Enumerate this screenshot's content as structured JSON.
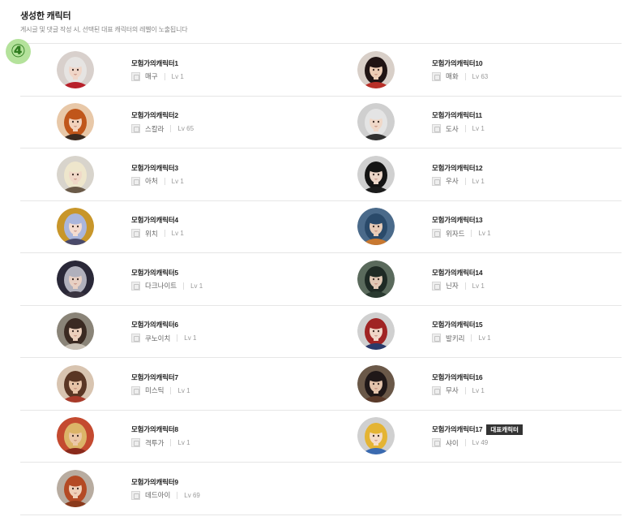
{
  "section": {
    "title": "생성한 캐릭터",
    "subtitle": "게시글 및 댓글 작성 시, 선택된 대표 캐릭터의 레벨이 노출됩니다",
    "annotation_marker": "④"
  },
  "representative_badge_label": "대표캐릭터",
  "colors": {
    "title": "#222222",
    "subtitle": "#888888",
    "divider": "#e6e6e6",
    "badge_bg": "#333333",
    "marker_bg": "#b4e29b",
    "marker_fg": "#2f7d1f"
  },
  "columns": [
    {
      "characters": [
        {
          "name": "모험가의캐릭터1",
          "class": "매구",
          "level": "Lv 1",
          "is_representative": false,
          "class_icon": "class-maegu-icon",
          "avatar": {
            "bg": "#d8d0cc",
            "hair": "#e6e4e2",
            "skin": "#f0d6c8",
            "outfit": "#b8202a"
          }
        },
        {
          "name": "모험가의캐릭터2",
          "class": "스칼라",
          "level": "Lv 65",
          "is_representative": false,
          "class_icon": "class-scholar-icon",
          "avatar": {
            "bg": "#e8c8a8",
            "hair": "#c0561a",
            "skin": "#f2d2bc",
            "outfit": "#3a2a20"
          }
        },
        {
          "name": "모험가의캐릭터3",
          "class": "아처",
          "level": "Lv 1",
          "is_representative": false,
          "class_icon": "class-archer-icon",
          "avatar": {
            "bg": "#d8d4cc",
            "hair": "#eee6cc",
            "skin": "#f0d8c8",
            "outfit": "#6a5a48"
          }
        },
        {
          "name": "모험가의캐릭터4",
          "class": "위치",
          "level": "Lv 1",
          "is_representative": false,
          "class_icon": "class-witch-icon",
          "avatar": {
            "bg": "#c8962a",
            "hair": "#aab6dc",
            "skin": "#f4dcd0",
            "outfit": "#4a4a6a"
          }
        },
        {
          "name": "모험가의캐릭터5",
          "class": "다크나이트",
          "level": "Lv 1",
          "is_representative": false,
          "class_icon": "class-darkknight-icon",
          "avatar": {
            "bg": "#2a2838",
            "hair": "#b0b0bc",
            "skin": "#e8d0c4",
            "outfit": "#3a3440"
          }
        },
        {
          "name": "모험가의캐릭터6",
          "class": "쿠노이치",
          "level": "Lv 1",
          "is_representative": false,
          "class_icon": "class-kunoichi-icon",
          "avatar": {
            "bg": "#8a8478",
            "hair": "#3a2a22",
            "skin": "#ecd0bc",
            "outfit": "#c8c0b4"
          }
        },
        {
          "name": "모험가의캐릭터7",
          "class": "미스틱",
          "level": "Lv 1",
          "is_representative": false,
          "class_icon": "class-mystic-icon",
          "avatar": {
            "bg": "#d8c4b0",
            "hair": "#5a3624",
            "skin": "#e8c4a8",
            "outfit": "#a83a2a"
          }
        },
        {
          "name": "모험가의캐릭터8",
          "class": "격투가",
          "level": "Lv 1",
          "is_representative": false,
          "class_icon": "class-striker-icon",
          "avatar": {
            "bg": "#c44a30",
            "hair": "#dcb468",
            "skin": "#ecc8a8",
            "outfit": "#8a2a1c"
          }
        },
        {
          "name": "모험가의캐릭터9",
          "class": "데드아이",
          "level": "Lv 69",
          "is_representative": false,
          "class_icon": "class-deadeye-icon",
          "avatar": {
            "bg": "#b8aca0",
            "hair": "#b44a24",
            "skin": "#f0d0b8",
            "outfit": "#8a3a1c"
          }
        }
      ]
    },
    {
      "characters": [
        {
          "name": "모험가의캐릭터10",
          "class": "매화",
          "level": "Lv 63",
          "is_representative": false,
          "class_icon": "class-maehwa-icon",
          "avatar": {
            "bg": "#d8cfc8",
            "hair": "#201414",
            "skin": "#ecccb4",
            "outfit": "#b83028"
          }
        },
        {
          "name": "모험가의캐릭터11",
          "class": "도사",
          "level": "Lv 1",
          "is_representative": false,
          "class_icon": "class-dosa-icon",
          "avatar": {
            "bg": "#cfcfcf",
            "hair": "#e4e4e4",
            "skin": "#f0d8c8",
            "outfit": "#303030"
          }
        },
        {
          "name": "모험가의캐릭터12",
          "class": "우사",
          "level": "Lv 1",
          "is_representative": false,
          "class_icon": "class-woosa-icon",
          "avatar": {
            "bg": "#d0d0d0",
            "hair": "#141414",
            "skin": "#ecd6c8",
            "outfit": "#1c1c1c"
          }
        },
        {
          "name": "모험가의캐릭터13",
          "class": "위자드",
          "level": "Lv 1",
          "is_representative": false,
          "class_icon": "class-wizard-icon",
          "avatar": {
            "bg": "#4a6a8a",
            "hair": "#2a4a6a",
            "skin": "#e8ccb8",
            "outfit": "#c87830"
          }
        },
        {
          "name": "모험가의캐릭터14",
          "class": "닌자",
          "level": "Lv 1",
          "is_representative": false,
          "class_icon": "class-ninja-icon",
          "avatar": {
            "bg": "#5a6a5c",
            "hair": "#1e2a24",
            "skin": "#e0c8b4",
            "outfit": "#2a3a30"
          }
        },
        {
          "name": "모험가의캐릭터15",
          "class": "발키리",
          "level": "Lv 1",
          "is_representative": false,
          "class_icon": "class-valkyrie-icon",
          "avatar": {
            "bg": "#d0d0d0",
            "hair": "#a02424",
            "skin": "#f0d6c8",
            "outfit": "#2a3a6a"
          }
        },
        {
          "name": "모험가의캐릭터16",
          "class": "무사",
          "level": "Lv 1",
          "is_representative": false,
          "class_icon": "class-musa-icon",
          "avatar": {
            "bg": "#6a5848",
            "hair": "#201818",
            "skin": "#e4c4ac",
            "outfit": "#5a3a2a"
          }
        },
        {
          "name": "모험가의캐릭터17",
          "class": "샤이",
          "level": "Lv 49",
          "is_representative": true,
          "class_icon": "class-shai-icon",
          "avatar": {
            "bg": "#d0d0d0",
            "hair": "#e4b434",
            "skin": "#f4dcc8",
            "outfit": "#3a6ab0"
          }
        }
      ]
    }
  ]
}
